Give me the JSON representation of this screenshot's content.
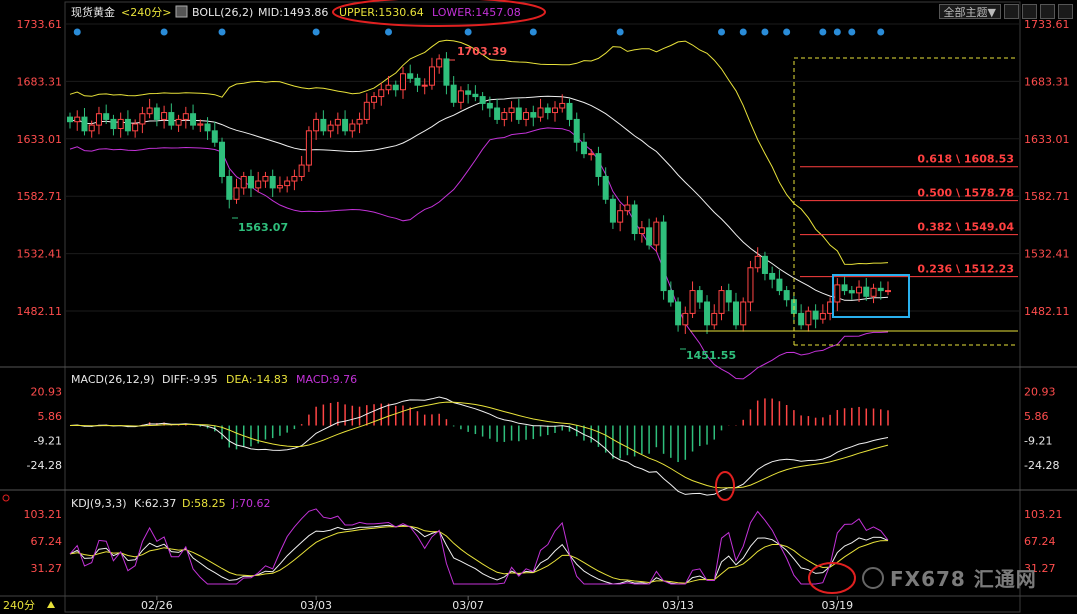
{
  "header": {
    "symbol": "现货黄金",
    "period": "<240分>",
    "boll_label": "BOLL(26,2)",
    "mid_label": "MID:1493.86",
    "upper_label": "UPPER:1530.64",
    "lower_label": "LOWER:1457.08",
    "theme_button": "全部主题",
    "theme_arrow": "▼"
  },
  "colors": {
    "up": "#ff4545",
    "down": "#2fbf7c",
    "mid": "#f0f0f0",
    "upper": "#e8e23a",
    "lower": "#c332d8",
    "price_axis": "#ff4d4d",
    "fib": "#ff4040",
    "highlight_box": "#29b0ee",
    "dots": "#2a8cd8",
    "annotation_red": "#e02020"
  },
  "panels": {
    "macd": {
      "label": "MACD(26,12,9)",
      "diff": "DIFF:-9.95",
      "dea": "DEA:-14.83",
      "macd": "MACD:9.76"
    },
    "kdj": {
      "label": "KDJ(9,3,3)",
      "k": "K:62.37",
      "d": "D:58.25",
      "j": "J:70.62"
    }
  },
  "price_axis_labels": [
    "1733.61",
    "1683.31",
    "1633.01",
    "1582.71",
    "1532.41",
    "1482.11"
  ],
  "macd_axis_labels": [
    "20.93",
    "5.86",
    "-9.21",
    "-24.28"
  ],
  "kdj_axis_labels": [
    "103.21",
    "67.24",
    "31.27"
  ],
  "date_labels": [
    "02/26",
    "03/03",
    "03/07",
    "03/13",
    "03/19"
  ],
  "period_corner": "240分",
  "annotations": {
    "high": "1703.39",
    "low1": "1563.07",
    "low2": "1451.55"
  },
  "fibonacci": [
    {
      "label": "0.618 \\ 1608.53",
      "price": 1608.53
    },
    {
      "label": "0.500 \\ 1578.78",
      "price": 1578.78
    },
    {
      "label": "0.382 \\ 1549.04",
      "price": 1549.04
    },
    {
      "label": "0.236 \\ 1512.23",
      "price": 1512.23
    }
  ],
  "brand": "FX678 汇通网",
  "chart_data": {
    "type": "candlestick",
    "title": "现货黄金 <240分>",
    "x_ticks": [
      "02/26",
      "03/03",
      "03/07",
      "03/13",
      "03/19"
    ],
    "price_range": [
      1440,
      1745
    ],
    "high": 1703.39,
    "lows": [
      1563.07,
      1451.55
    ],
    "boll": {
      "period": "26,2",
      "mid": 1493.86,
      "upper": 1530.64,
      "lower": 1457.08
    },
    "macd": {
      "params": "26,12,9",
      "diff": -9.95,
      "dea": -14.83,
      "macd": 9.76
    },
    "kdj": {
      "params": "9,3,3",
      "k": 62.37,
      "d": 58.25,
      "j": 70.62
    },
    "series": [
      {
        "name": "close",
        "values": [
          1648,
          1652,
          1640,
          1645,
          1655,
          1650,
          1642,
          1650,
          1640,
          1646,
          1655,
          1660,
          1650,
          1656,
          1645,
          1650,
          1655,
          1645,
          1646,
          1640,
          1630,
          1600,
          1580,
          1590,
          1600,
          1590,
          1596,
          1600,
          1590,
          1592,
          1596,
          1600,
          1610,
          1640,
          1650,
          1640,
          1645,
          1650,
          1640,
          1646,
          1650,
          1665,
          1670,
          1676,
          1680,
          1676,
          1690,
          1686,
          1680,
          1680,
          1696,
          1703,
          1680,
          1665,
          1675,
          1672,
          1670,
          1664,
          1660,
          1650,
          1656,
          1660,
          1650,
          1656,
          1652,
          1660,
          1656,
          1660,
          1664,
          1650,
          1630,
          1620,
          1620,
          1600,
          1580,
          1560,
          1570,
          1575,
          1550,
          1555,
          1540,
          1560,
          1500,
          1490,
          1470,
          1480,
          1500,
          1490,
          1470,
          1480,
          1500,
          1490,
          1470,
          1490,
          1520,
          1530,
          1515,
          1510,
          1500,
          1492,
          1480,
          1470,
          1482,
          1475,
          1480,
          1490,
          1505,
          1500,
          1498,
          1503,
          1495,
          1502,
          1500,
          1500
        ]
      }
    ],
    "fibonacci_levels": [
      {
        "ratio": 0.618,
        "price": 1608.53
      },
      {
        "ratio": 0.5,
        "price": 1578.78
      },
      {
        "ratio": 0.382,
        "price": 1549.04
      },
      {
        "ratio": 0.236,
        "price": 1512.23
      }
    ]
  }
}
